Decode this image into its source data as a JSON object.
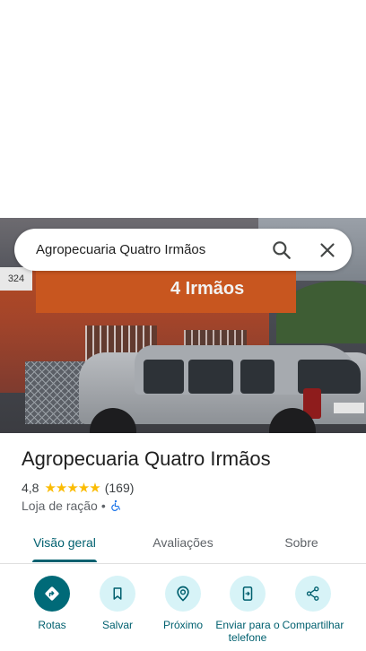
{
  "search": {
    "query": "Agropecuaria Quatro Irmãos"
  },
  "hero": {
    "number_plate": "324",
    "sign_text": "4 Irmãos"
  },
  "place": {
    "name": "Agropecuaria Quatro Irmãos",
    "rating": "4,8",
    "stars": "★★★★★",
    "review_count": "(169)",
    "category": "Loja de ração",
    "separator": "•"
  },
  "tabs": [
    {
      "label": "Visão geral",
      "active": true
    },
    {
      "label": "Avaliações",
      "active": false
    },
    {
      "label": "Sobre",
      "active": false
    }
  ],
  "actions": [
    {
      "label": "Rotas",
      "icon": "directions-icon"
    },
    {
      "label": "Salvar",
      "icon": "bookmark-icon"
    },
    {
      "label": "Próximo",
      "icon": "nearby-icon"
    },
    {
      "label": "Enviar para o telefone",
      "icon": "send-to-phone-icon"
    },
    {
      "label": "Compartilhar",
      "icon": "share-icon"
    }
  ],
  "colors": {
    "accent": "#00606f",
    "primary_button": "#006a78",
    "tonal_button": "#d7f3f7",
    "star": "#fbbc04"
  }
}
